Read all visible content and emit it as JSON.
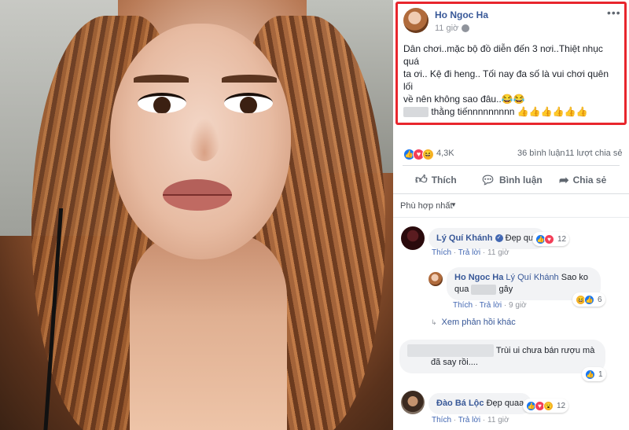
{
  "post": {
    "author": "Ho Ngoc Ha",
    "time": "11 giờ",
    "lines": [
      "Dân chơi..mặc bộ đồ diễn đến 3 nơi..Thiệt nhục quá",
      "ta ơi.. Kệ đi heng.. Tối nay đa số là vui chơi quên lối",
      "về nên không sao đâu..😂😂",
      "thằng tiếnnnnnnnnn 👍👍👍👍👍👍"
    ]
  },
  "stats": {
    "reactions": "4,3K",
    "comments": "36 bình luận",
    "shares": "11 lượt chia sẻ"
  },
  "actions": {
    "like": "Thích",
    "comment": "Bình luận",
    "share": "Chia sẻ"
  },
  "sort": "Phù hợp nhất",
  "comments": [
    {
      "name": "Lý Quí Khánh",
      "text": "Đẹp quá",
      "like": "Thích",
      "reply": "Trả lời",
      "time": "11 giờ",
      "reaction_count": "12",
      "reply_item": {
        "name": "Ho Ngoc Ha",
        "mention": "Lý Quí Khánh",
        "text_a": "Sao ko",
        "text_b": "qua",
        "text_c": "gây",
        "like": "Thích",
        "reply": "Trả lời",
        "time": "9 giờ",
        "reaction_count": "6"
      },
      "more_replies": "Xem phản hồi khác"
    },
    {
      "name": "",
      "text_a": "Trùi ui chưa bán rượu mà",
      "text_b": "đã say rồi....",
      "reaction_count": "1"
    },
    {
      "name": "Đào Bá Lộc",
      "text": "Đẹp quaa",
      "like": "Thích",
      "reply": "Trả lời",
      "time": "11 giờ",
      "reaction_count": "12"
    }
  ],
  "icons": {
    "more": "more-icon",
    "globe": "globe-icon",
    "like": "thumbs-up-icon",
    "comment": "speech-bubble-icon",
    "share": "share-arrow-icon"
  },
  "colors": {
    "highlight_border": "#e8262d",
    "link": "#385898",
    "like_blue": "#1877f2"
  }
}
